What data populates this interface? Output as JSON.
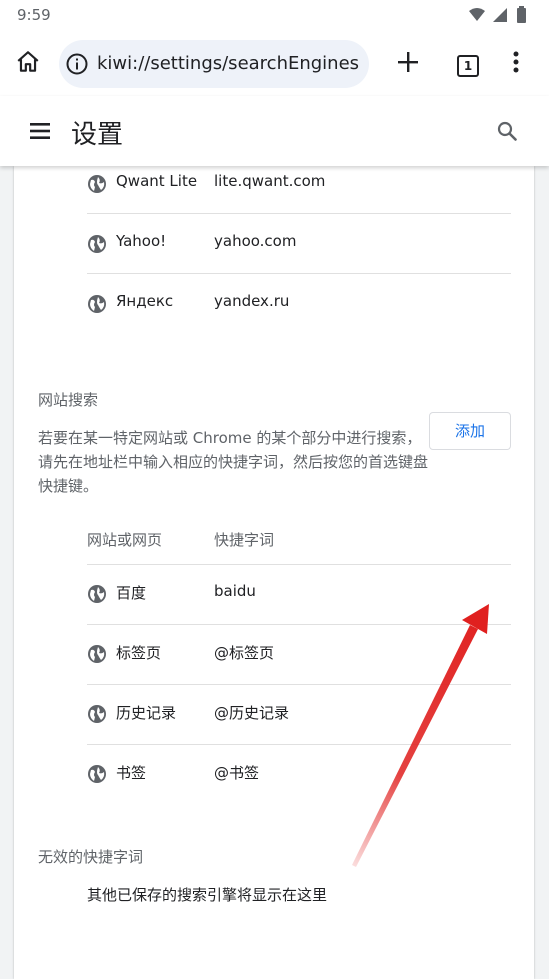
{
  "status_bar": {
    "time": "9:59"
  },
  "toolbar": {
    "url": "kiwi://settings/searchEngines",
    "tab_count": "1"
  },
  "header": {
    "title": "设置"
  },
  "default_engines": [
    {
      "name": "Qwant Lite",
      "keyword": "lite.qwant.com"
    },
    {
      "name": "Yahoo!",
      "keyword": "yahoo.com"
    },
    {
      "name": "Яндекс",
      "keyword": "yandex.ru"
    }
  ],
  "site_search": {
    "title": "网站搜索",
    "description": "若要在某一特定网站或 Chrome 的某个部分中进行搜索，请先在地址栏中输入相应的快捷字词，然后按您的首选键盘快捷键。",
    "add_label": "添加",
    "col_site": "网站或网页",
    "col_keyword": "快捷字词",
    "items": [
      {
        "name": "百度",
        "keyword": "baidu"
      },
      {
        "name": "标签页",
        "keyword": "@标签页"
      },
      {
        "name": "历史记录",
        "keyword": "@历史记录"
      },
      {
        "name": "书签",
        "keyword": "@书签"
      }
    ]
  },
  "inactive": {
    "title": "无效的快捷字词",
    "empty_text": "其他已保存的搜索引擎将显示在这里"
  },
  "colors": {
    "accent": "#1a73e8",
    "annotation_arrow": "#e0201f"
  }
}
